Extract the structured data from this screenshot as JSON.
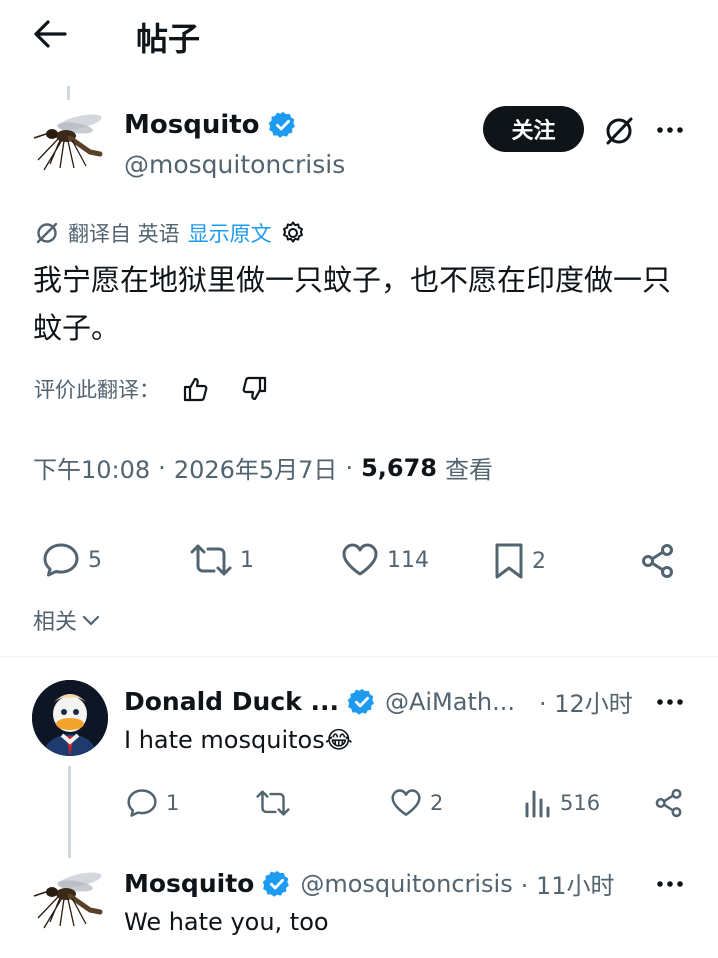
{
  "header": {
    "title": "帖子"
  },
  "post": {
    "name": "Mosquito",
    "handle": "@mosquitoncrisis",
    "follow_label": "关注",
    "translated_from": "翻译自 英语",
    "show_original": "显示原文",
    "text": "我宁愿在地狱里做一只蚊子，也不愿在印度做一只蚊子。",
    "rate_translation": "评价此翻译：",
    "time": "下午10:08",
    "date": "2026年5月7日",
    "separator": "·",
    "views_count": "5,678",
    "views_label": "查看",
    "replies": "5",
    "reposts": "1",
    "likes": "114",
    "bookmarks": "2"
  },
  "related_label": "相关",
  "replies": [
    {
      "name": "Donald Duck ...",
      "handle": "@AiMath...",
      "time": "· 12小时",
      "text": "I hate mosquitos",
      "emoji": "😂",
      "replies": "1",
      "reposts": "",
      "likes": "2",
      "views": "516"
    },
    {
      "name": "Mosquito",
      "handle": "@mosquitoncrisis",
      "time": "· 11小时",
      "text": "We hate you, too"
    }
  ],
  "colors": {
    "accent": "#1d9bf0",
    "text": "#0f1419",
    "muted": "#536471"
  },
  "icons": [
    "back-arrow-icon",
    "verified-badge-icon",
    "grok-icon",
    "more-icon",
    "translate-icon",
    "settings-icon",
    "thumbs-up-icon",
    "thumbs-down-icon",
    "reply-icon",
    "repost-icon",
    "like-icon",
    "bookmark-icon",
    "share-icon",
    "chevron-down-icon",
    "views-icon"
  ]
}
